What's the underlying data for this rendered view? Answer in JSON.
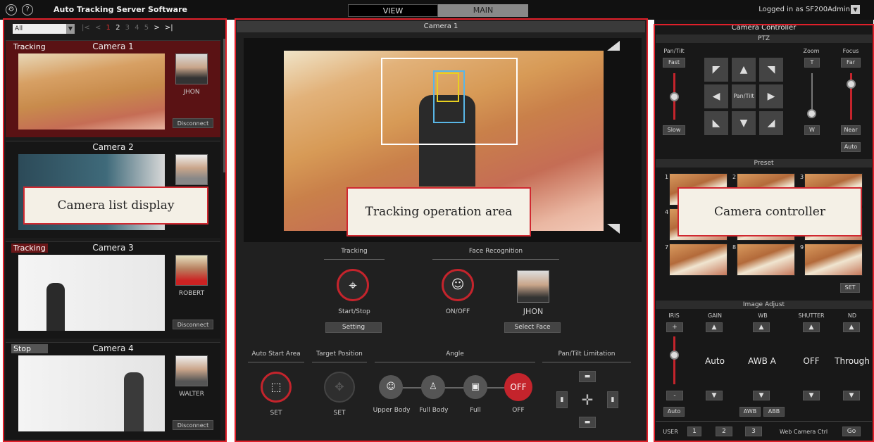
{
  "app": {
    "title": "Auto Tracking Server Software",
    "tabs": [
      "VIEW",
      "MAIN"
    ],
    "active_tab": "MAIN",
    "login": "Logged in as SF200Admin",
    "help_icon": "?"
  },
  "camera_list": {
    "filter": "All",
    "pages": [
      "|<",
      "<",
      "1",
      "2",
      "3",
      "4",
      "5",
      ">",
      ">|"
    ],
    "cameras": [
      {
        "name": "Camera 1",
        "status": "Tracking",
        "face_name": "JHON",
        "disconnect": "Disconnect"
      },
      {
        "name": "Camera 2",
        "status": "",
        "face_name": "",
        "disconnect": ""
      },
      {
        "name": "Camera 3",
        "status": "Tracking",
        "face_name": "ROBERT",
        "disconnect": "Disconnect"
      },
      {
        "name": "Camera 4",
        "status": "Stop",
        "face_name": "WALTER",
        "disconnect": "Disconnect"
      }
    ],
    "callout": "Camera list display"
  },
  "tracking": {
    "header": "Camera 1",
    "callout": "Tracking operation area",
    "tracking_label": "Tracking",
    "start_stop": "Start/Stop",
    "setting": "Setting",
    "face_label": "Face Recognition",
    "onoff": "ON/OFF",
    "face_name": "JHON",
    "select_face": "Select Face",
    "auto_start": "Auto Start Area",
    "auto_set": "SET",
    "target_pos": "Target Position",
    "target_set": "SET",
    "angle": "Angle",
    "angle_opts": [
      "Upper Body",
      "Full Body",
      "Full",
      "OFF"
    ],
    "off_btn": "OFF",
    "pt_limit": "Pan/Tilt Limitation"
  },
  "controller": {
    "title": "Camera Controller",
    "callout": "Camera controller",
    "ptz": "PTZ",
    "pan_tilt": "Pan/Tilt",
    "fast": "Fast",
    "slow": "Slow",
    "center_label": "Pan/Tilt",
    "zoom": "Zoom",
    "t": "T",
    "w": "W",
    "focus": "Focus",
    "far": "Far",
    "near": "Near",
    "auto": "Auto",
    "preset": "Preset",
    "preset_nums": [
      "1",
      "2",
      "3",
      "4",
      "",
      "",
      "7",
      "8",
      "9"
    ],
    "set": "SET",
    "image_adjust": "Image Adjust",
    "iris": "IRIS",
    "gain": "GAIN",
    "wb": "WB",
    "shutter": "SHUTTER",
    "nd": "ND",
    "plus": "+",
    "minus": "-",
    "gain_val": "Auto",
    "wb_val": "AWB A",
    "shutter_val": "OFF",
    "nd_val": "Through",
    "iris_auto": "Auto",
    "awb": "AWB",
    "abb": "ABB",
    "user": "USER",
    "user_btns": [
      "1",
      "2",
      "3"
    ],
    "webctrl": "Web Camera Ctrl",
    "go": "Go"
  }
}
